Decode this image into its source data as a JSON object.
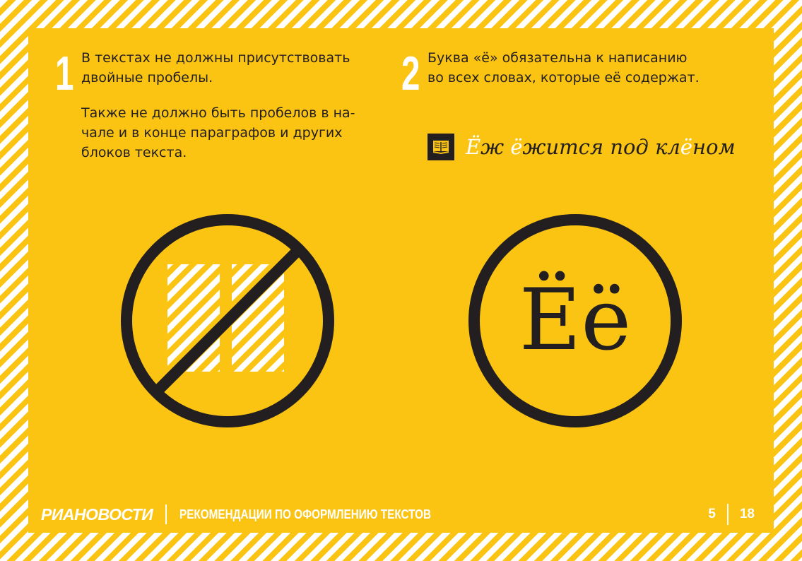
{
  "section1": {
    "number": "1",
    "line1": "В текстах не должны присутствовать",
    "line2": "двойные пробелы.",
    "para_line1": "Также не должно быть пробелов в на-",
    "para_line2": "чале и в конце параграфов и других",
    "para_line3": "блоков текста."
  },
  "section2": {
    "number": "2",
    "line1": "Буква «ё» обязательна к написанию",
    "line2": "во всех словах, которые её содержат.",
    "example": {
      "icon": "open-book-icon",
      "part1": "Ё",
      "part2": "ж ",
      "part3": "ё",
      "part4": "жится под кл",
      "part5": "ё",
      "part6": "ном"
    },
    "big_letters": "Ёё"
  },
  "icons": {
    "left": "no-double-space-icon",
    "right": "yo-letter-icon"
  },
  "footer": {
    "brand": "РИАНОВОСТИ",
    "title": "РЕКОМЕНДАЦИИ ПО ОФОРМЛЕНИЮ ТЕКСТОВ",
    "page_current": "5",
    "page_total": "18"
  },
  "colors": {
    "accent_yellow": "#fbc413",
    "dark": "#231f20",
    "white": "#ffffff"
  }
}
